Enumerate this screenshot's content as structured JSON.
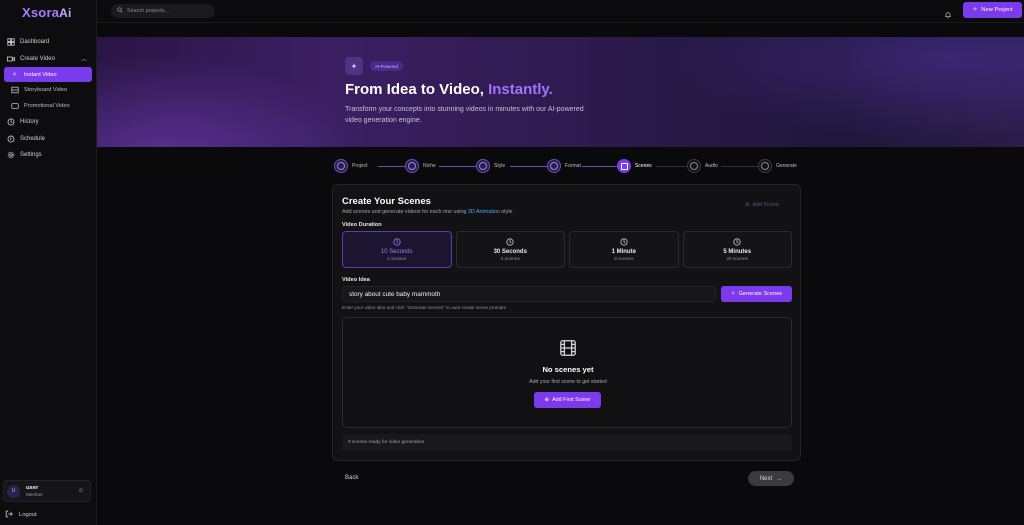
{
  "brand": {
    "logo_text": "Xsora",
    "logo_suffix": "Ai"
  },
  "sidebar": {
    "items": [
      {
        "label": "Dashboard",
        "icon": "dashboard-icon"
      },
      {
        "label": "Create Video",
        "icon": "video-icon",
        "expanded": true
      },
      {
        "label": "History",
        "icon": "history-icon"
      },
      {
        "label": "Schedule",
        "icon": "schedule-icon"
      },
      {
        "label": "Settings",
        "icon": "gear-icon"
      }
    ],
    "sub_items": [
      {
        "label": "Instant Video",
        "active": true
      },
      {
        "label": "Storyboard Video",
        "active": false
      },
      {
        "label": "Promotional Video",
        "active": false
      }
    ],
    "user": {
      "initial": "U",
      "name": "user",
      "role": "Member"
    },
    "logout_label": "Logout"
  },
  "topbar": {
    "search_placeholder": "Search projects...",
    "new_project_label": "New Project"
  },
  "hero": {
    "badge": "AI-Powered",
    "title_main": "From Idea to Video, ",
    "title_accent": "Instantly.",
    "subtitle": "Transform your concepts into stunning videos in minutes with our AI-powered video generation engine."
  },
  "stepper": {
    "steps": [
      {
        "label": "Project",
        "state": "done"
      },
      {
        "label": "Niche",
        "state": "done"
      },
      {
        "label": "Style",
        "state": "done"
      },
      {
        "label": "Format",
        "state": "done"
      },
      {
        "label": "Scenes",
        "state": "active"
      },
      {
        "label": "Audio",
        "state": "future"
      },
      {
        "label": "Generate",
        "state": "future"
      }
    ]
  },
  "scenes": {
    "title": "Create Your Scenes",
    "subtitle_pre": "Add scenes and generate videos for each one using ",
    "subtitle_style": "3D Animation",
    "subtitle_post": " style",
    "add_scene_label": "Add Scene",
    "duration_label": "Video Duration",
    "durations": [
      {
        "title": "10 Seconds",
        "scenes": "2 scenes",
        "selected": true
      },
      {
        "title": "30 Seconds",
        "scenes": "4 scenes",
        "selected": false
      },
      {
        "title": "1 Minute",
        "scenes": "8 scenes",
        "selected": false
      },
      {
        "title": "5 Minutes",
        "scenes": "20 scenes",
        "selected": false
      }
    ],
    "idea_label": "Video Idea",
    "idea_value": "story about cute baby mammoth",
    "generate_label": "Generate Scenes",
    "idea_help": "Enter your video idea and click \"Generate Scenes\" to auto-create scene prompts",
    "empty_title": "No scenes yet",
    "empty_sub": "Add your first scene to get started",
    "add_first_label": "Add First Scene",
    "status_text": "0 scenes ready for video generation"
  },
  "footer": {
    "back_label": "Back",
    "next_label": "Next"
  },
  "colors": {
    "accent": "#7c3aed",
    "accent_text": "#a770ff",
    "link": "#4aa3ff"
  }
}
